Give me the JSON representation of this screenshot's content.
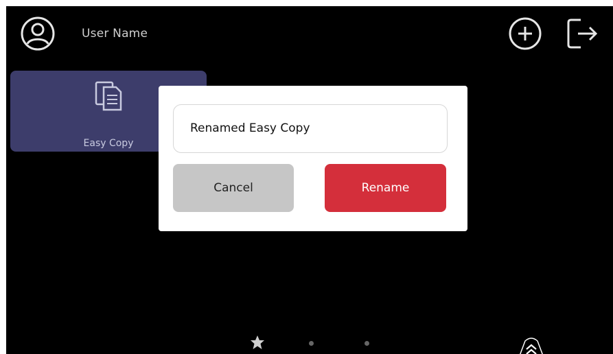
{
  "header": {
    "user_name": "User Name",
    "icons": {
      "avatar": "user-circle-icon",
      "add": "plus-circle-icon",
      "logout": "logout-icon"
    }
  },
  "tiles": [
    {
      "label": "Easy Copy",
      "icon": "copy-document-icon",
      "color": "#3d3d6b"
    }
  ],
  "dialog": {
    "input_value": "Renamed Easy Copy",
    "cancel_label": "Cancel",
    "rename_label": "Rename",
    "colors": {
      "cancel": "#c6c6c6",
      "rename": "#d42f3b"
    }
  },
  "pager": {
    "home_icon": "star-icon",
    "page_count": 3,
    "current_page": 1,
    "scroll_icon": "double-chevron-up-icon"
  }
}
